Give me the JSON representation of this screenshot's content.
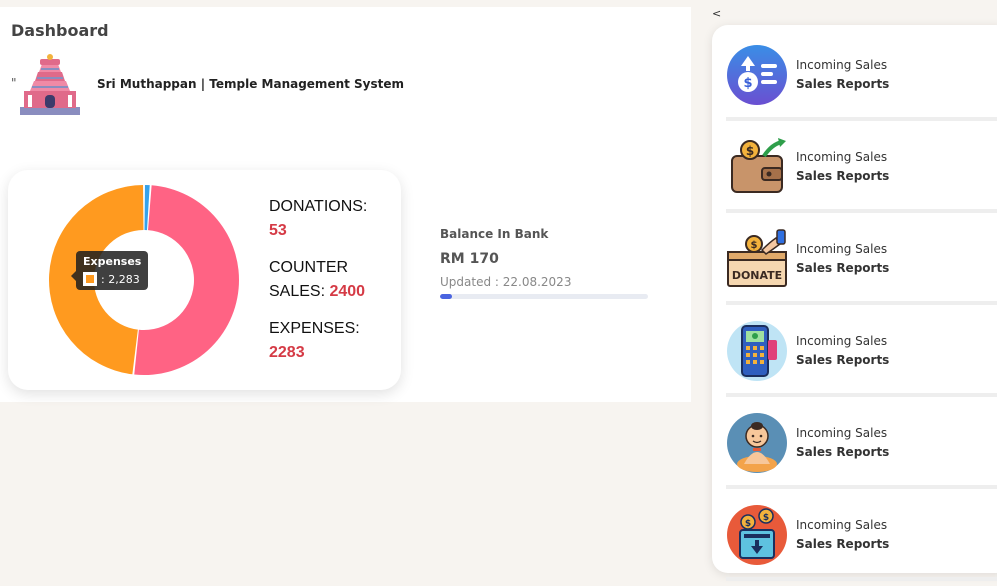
{
  "header": {
    "title": "Dashboard",
    "quote_mark": "\"",
    "system_name": "Sri Muthappan | Temple Management System"
  },
  "stats": {
    "donations_label": "DONATIONS:",
    "donations_value": "53",
    "counter_label_1": "COUNTER",
    "counter_label_2": "SALES:",
    "counter_value": "2400",
    "expenses_label": "EXPENSES:",
    "expenses_value": "2283"
  },
  "tooltip": {
    "title": "Expenses",
    "value": ": 2,283"
  },
  "chart_data": {
    "type": "pie",
    "donut": true,
    "categories": [
      "Donations",
      "Counter Sales",
      "Expenses"
    ],
    "values": [
      53,
      2400,
      2283
    ],
    "colors": [
      "#36a2eb",
      "#ff6384",
      "#ff9a1f"
    ]
  },
  "balance": {
    "title": "Balance In Bank",
    "amount": "RM 170",
    "updated": "Updated : 22.08.2023",
    "progress_fraction": 0.06
  },
  "side_panel": {
    "toggle": "<",
    "items": [
      {
        "line1": "Incoming Sales",
        "line2": "Sales Reports",
        "icon": "money-upload-icon"
      },
      {
        "line1": "Incoming Sales",
        "line2": "Sales Reports",
        "icon": "wallet-icon"
      },
      {
        "line1": "Incoming Sales",
        "line2": "Sales Reports",
        "icon": "donate-box-icon"
      },
      {
        "line1": "Incoming Sales",
        "line2": "Sales Reports",
        "icon": "pos-terminal-icon"
      },
      {
        "line1": "Incoming Sales",
        "line2": "Sales Reports",
        "icon": "monk-icon"
      },
      {
        "line1": "Incoming Sales",
        "line2": "Sales Reports",
        "icon": "cash-register-icon"
      }
    ]
  },
  "colors": {
    "accent_red": "#d53a45",
    "progress_blue": "#4a64e0",
    "donut_orange": "#ff9a1f",
    "donut_pink": "#ff6384"
  }
}
